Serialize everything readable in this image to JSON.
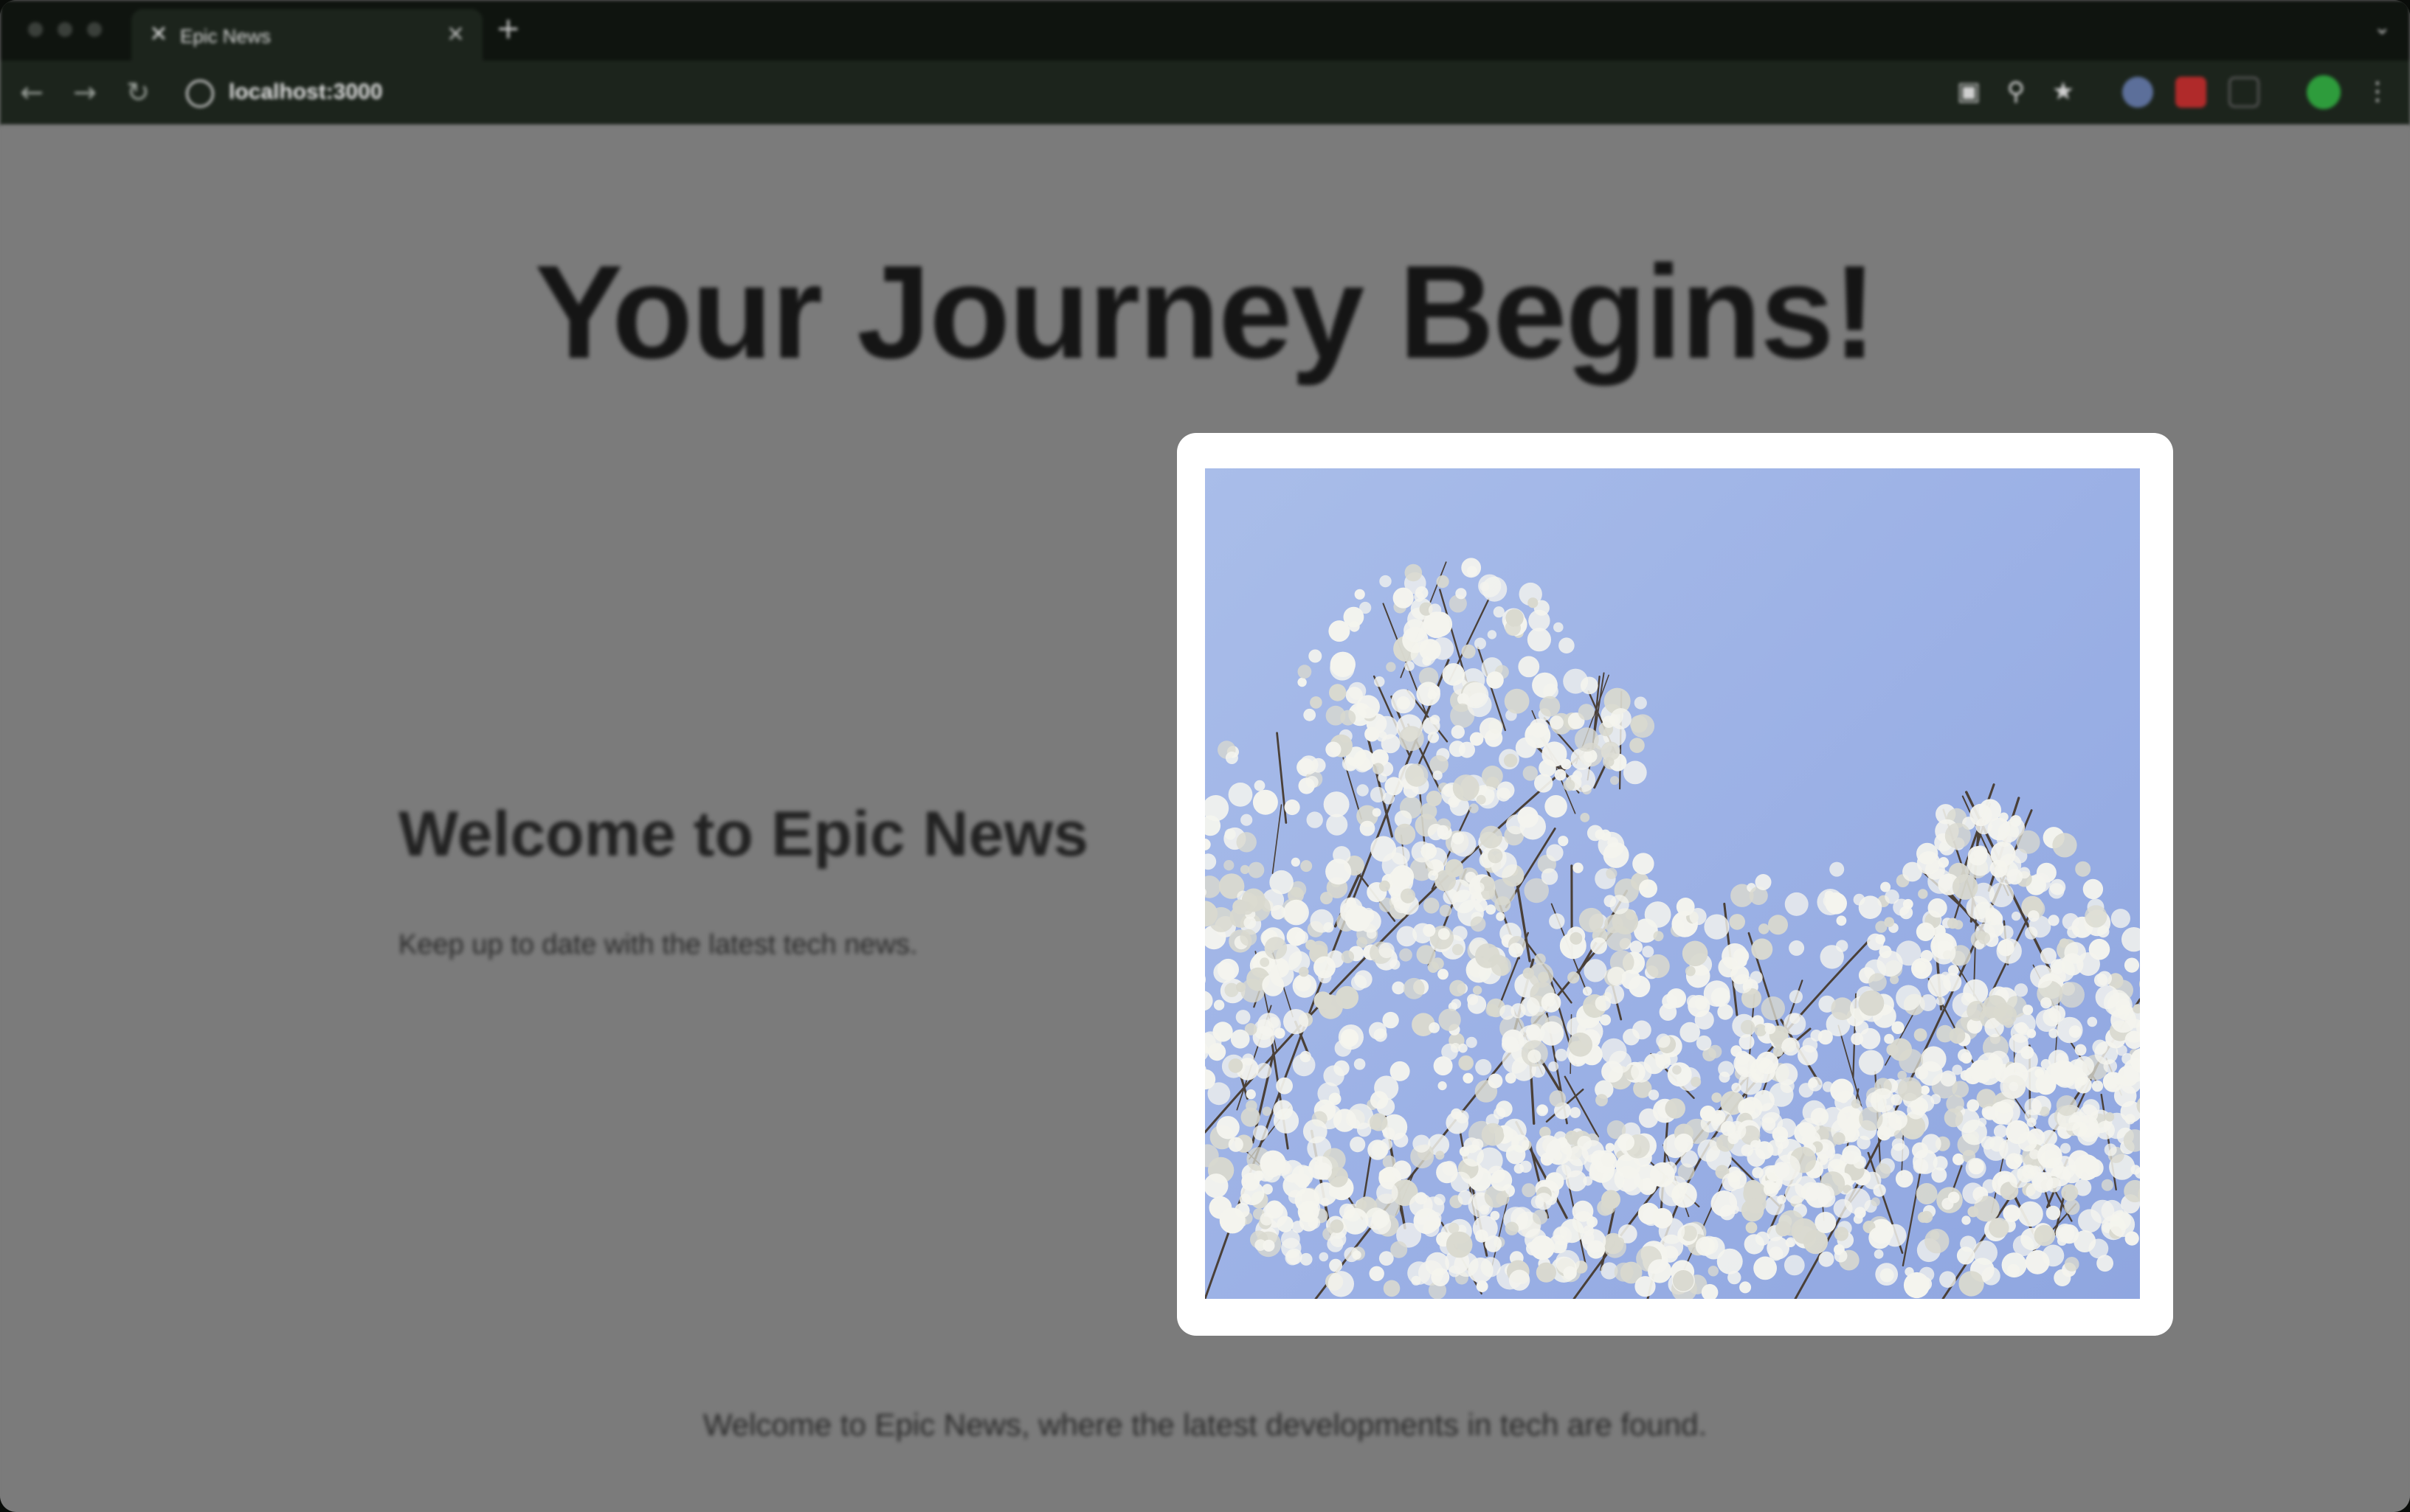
{
  "browser": {
    "tab_title": "Epic News",
    "tab_favicon": "epic-news-logo-icon",
    "url": "localhost:3000",
    "nav_icons": [
      "back-arrow-icon",
      "forward-arrow-icon",
      "reload-icon"
    ],
    "toolbar_icons": [
      "cast-icon",
      "zoom-icon",
      "bookmark-star-icon",
      "extension-icon",
      "adblock-icon",
      "puzzle-icon",
      "profile-avatar"
    ]
  },
  "page": {
    "hero_title": "Your Journey Begins!",
    "welcome_heading": "Welcome to Epic News",
    "welcome_text": "Keep up to date with the latest tech news.",
    "footer_text": "Welcome to Epic News, where the latest developments in tech are found."
  },
  "modal": {
    "image_subject": "white blossoming tree branches against a blue sky",
    "sky_color": "#9db2e6",
    "blossom_color": "#f4f4ee"
  }
}
